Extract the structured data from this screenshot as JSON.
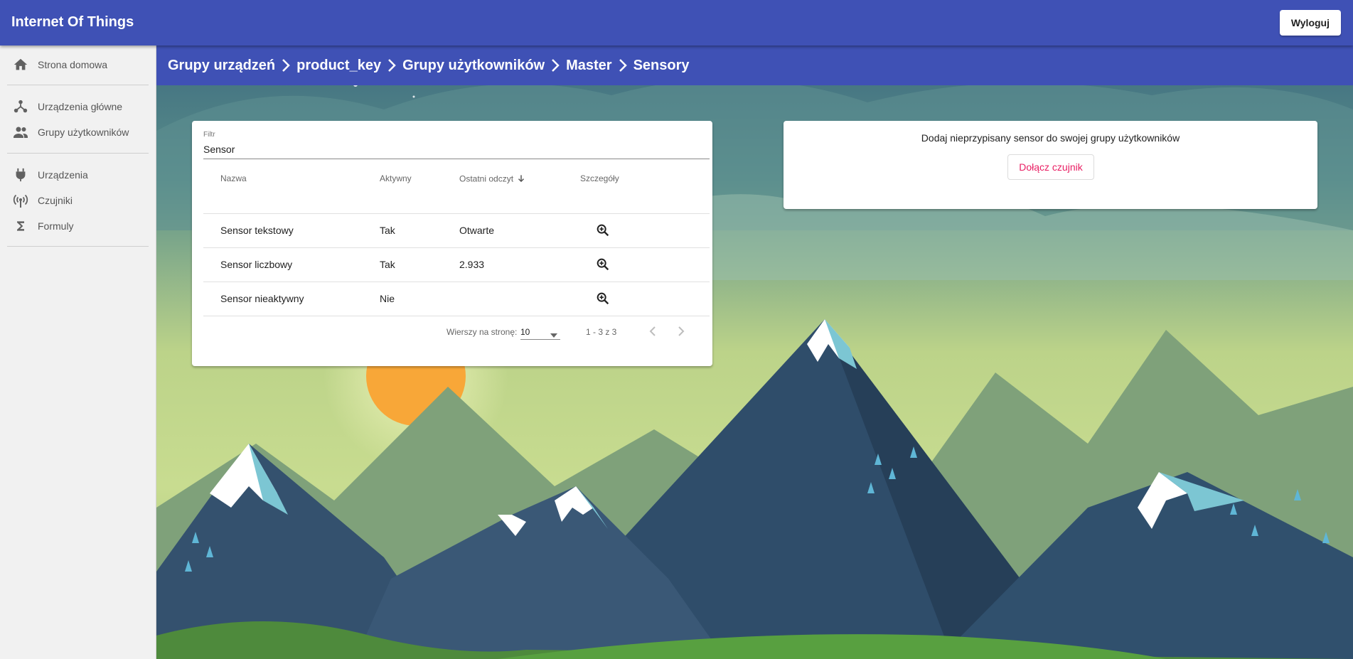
{
  "app": {
    "title": "Internet Of Things",
    "logout_label": "Wyloguj"
  },
  "sidebar": {
    "items": [
      {
        "label": "Strona domowa",
        "icon": "home-icon"
      },
      {
        "label": "Urządzenia główne",
        "icon": "hub-icon"
      },
      {
        "label": "Grupy użytkowników",
        "icon": "people-icon"
      },
      {
        "label": "Urządzenia",
        "icon": "plug-icon"
      },
      {
        "label": "Czujniki",
        "icon": "antenna-icon"
      },
      {
        "label": "Formuly",
        "icon": "sigma-icon"
      }
    ]
  },
  "breadcrumb": [
    "Grupy urządzeń",
    "product_key",
    "Grupy użytkowników",
    "Master",
    "Sensory"
  ],
  "filter": {
    "label": "Filtr",
    "value": "Sensor"
  },
  "table": {
    "headers": [
      "Nazwa",
      "Aktywny",
      "Ostatni odczyt",
      "Szczegóły"
    ],
    "sorted_column": "Ostatni odczyt",
    "sort_direction": "desc",
    "rows": [
      {
        "name": "Sensor tekstowy",
        "active": "Tak",
        "last_reading": "Otwarte"
      },
      {
        "name": "Sensor liczbowy",
        "active": "Tak",
        "last_reading": "2.933"
      },
      {
        "name": "Sensor nieaktywny",
        "active": "Nie",
        "last_reading": ""
      }
    ]
  },
  "paginator": {
    "label": "Wierszy na stronę:",
    "page_size": "10",
    "range": "1 - 3 z 3"
  },
  "add_sensor": {
    "text": "Dodaj nieprzypisany sensor do swojej grupy użytkowników",
    "button_label": "Dołącz czujnik"
  },
  "colors": {
    "primary": "#3f51b5",
    "accent": "#e91e63",
    "sidebar_bg": "#f1f1f1"
  }
}
